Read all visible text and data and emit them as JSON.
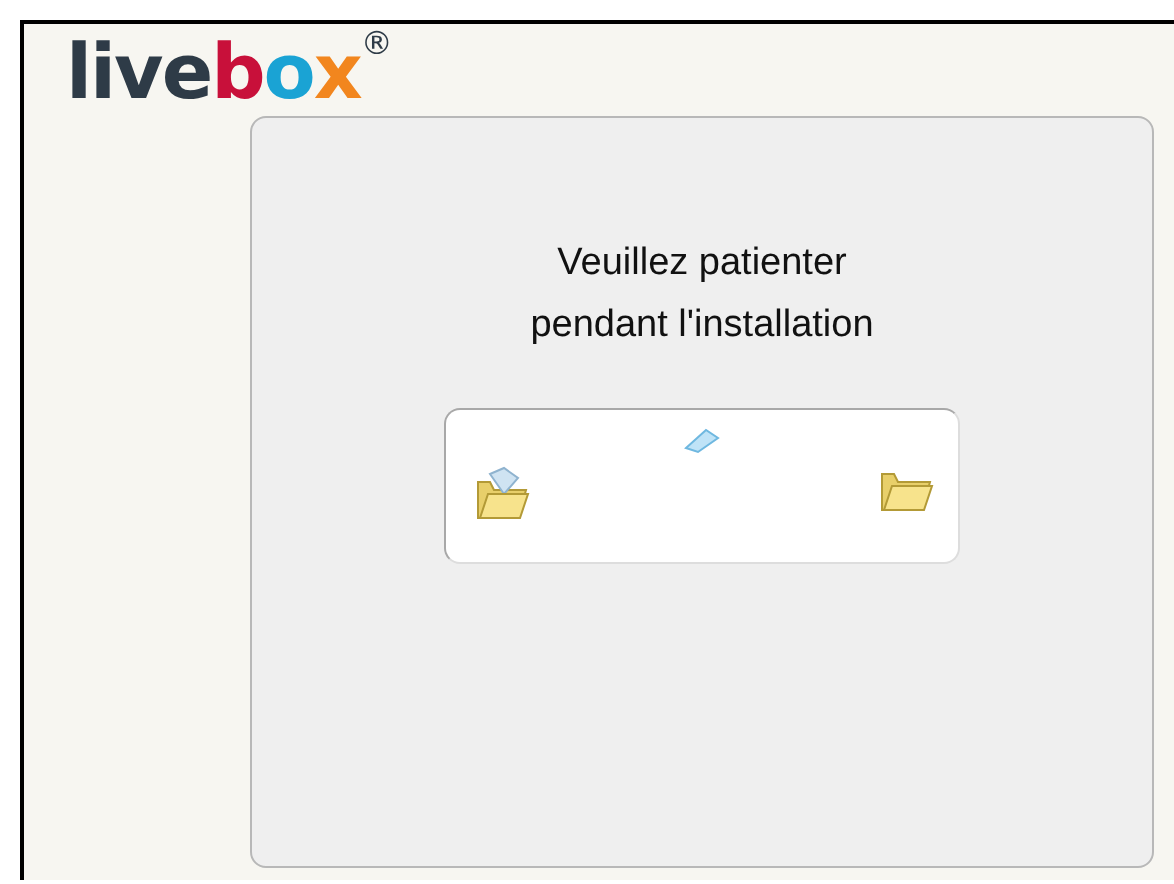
{
  "logo": {
    "parts": [
      {
        "text": "live",
        "color": "#2e3b47"
      },
      {
        "text": "b",
        "color": "#c8103a"
      },
      {
        "text": "o",
        "color": "#1aa3d4"
      },
      {
        "text": "x",
        "color": "#f2861e"
      }
    ],
    "mark": "®"
  },
  "panel": {
    "message": [
      "Veuillez patienter",
      "pendant l'installation"
    ]
  }
}
